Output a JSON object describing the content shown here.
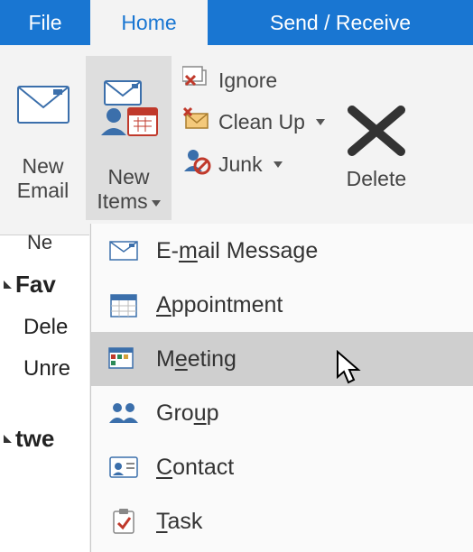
{
  "tabs": {
    "file": "File",
    "home": "Home",
    "send_receive": "Send / Receive"
  },
  "ribbon": {
    "new_email": {
      "line1": "New",
      "line2": "Email"
    },
    "new_items": {
      "line1": "New",
      "line2": "Items"
    },
    "ignore": "Ignore",
    "clean_up": "Clean Up",
    "junk": "Junk",
    "delete": "Delete"
  },
  "nav": {
    "ne_fragment": "Ne",
    "favorites": "Fav",
    "deleted_frag": "Dele",
    "unread_frag": "Unre",
    "twe_frag": "twe"
  },
  "menu": {
    "email": {
      "pre": "E-",
      "u": "m",
      "post": "ail Message"
    },
    "appointment": {
      "u": "A",
      "post": "ppointment"
    },
    "meeting": {
      "pre": "M",
      "u": "e",
      "post": "eting"
    },
    "group": {
      "pre": "Gro",
      "u": "u",
      "post": "p"
    },
    "contact": {
      "u": "C",
      "post": "ontact"
    },
    "task": {
      "u": "T",
      "post": "ask"
    }
  }
}
